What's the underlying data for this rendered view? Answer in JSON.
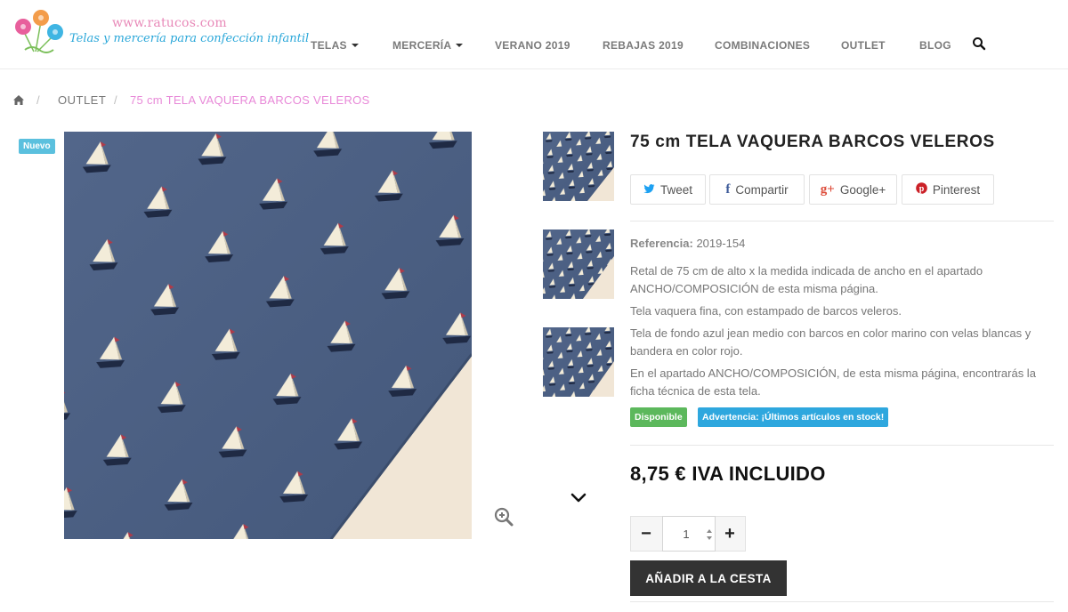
{
  "header": {
    "logo_url_text": "www.ratucos.com",
    "logo_tagline": "Telas y mercería para confección infantil",
    "nav": [
      {
        "label": "TELAS",
        "dropdown": true
      },
      {
        "label": "MERCERÍA",
        "dropdown": true
      },
      {
        "label": "VERANO 2019",
        "dropdown": false
      },
      {
        "label": "REBAJAS 2019",
        "dropdown": false
      },
      {
        "label": "COMBINACIONES",
        "dropdown": false
      },
      {
        "label": "OUTLET",
        "dropdown": false
      },
      {
        "label": "BLOG",
        "dropdown": false
      }
    ],
    "search_icon": "search-icon"
  },
  "breadcrumb": {
    "home_icon": "home-icon",
    "separator": "/",
    "items": [
      "OUTLET"
    ],
    "current": "75 cm TELA VAQUERA BARCOS VELEROS"
  },
  "gallery": {
    "badge": "Nuevo",
    "zoom_icon": "zoom-in-icon",
    "scroll_icon": "chevron-down-icon"
  },
  "product": {
    "title": "75 cm TELA VAQUERA BARCOS VELEROS",
    "share": [
      {
        "label": "Tweet",
        "icon": "twitter-icon"
      },
      {
        "label": "Compartir",
        "icon": "facebook-icon"
      },
      {
        "label": "Google+",
        "icon": "google-plus-icon"
      },
      {
        "label": "Pinterest",
        "icon": "pinterest-icon"
      }
    ],
    "reference_label": "Referencia:",
    "reference_value": "2019-154",
    "description": [
      "Retal de 75 cm de alto x la medida indicada de ancho en el apartado ANCHO/COMPOSICIÓN de esta misma página.",
      "Tela vaquera fina, con estampado de barcos veleros.",
      "Tela de fondo azul jean medio con barcos en color marino con velas blancas y bandera en color rojo.",
      "En el apartado ANCHO/COMPOSICIÓN, de esta misma página, encontrarás la ficha técnica de esta tela."
    ],
    "availability": "Disponible",
    "warning": "Advertencia: ¡Últimos artículos en stock!",
    "price": "8,75 € IVA INCLUIDO",
    "quantity": "1",
    "qty_minus": "−",
    "qty_plus": "+",
    "add_to_cart": "AÑADIR A LA CESTA"
  },
  "colors": {
    "accent_pink": "#e889d8",
    "accent_blue": "#5bc0de",
    "available_green": "#5cb85c",
    "dark_button": "#333333",
    "denim": "#4a5e80"
  }
}
